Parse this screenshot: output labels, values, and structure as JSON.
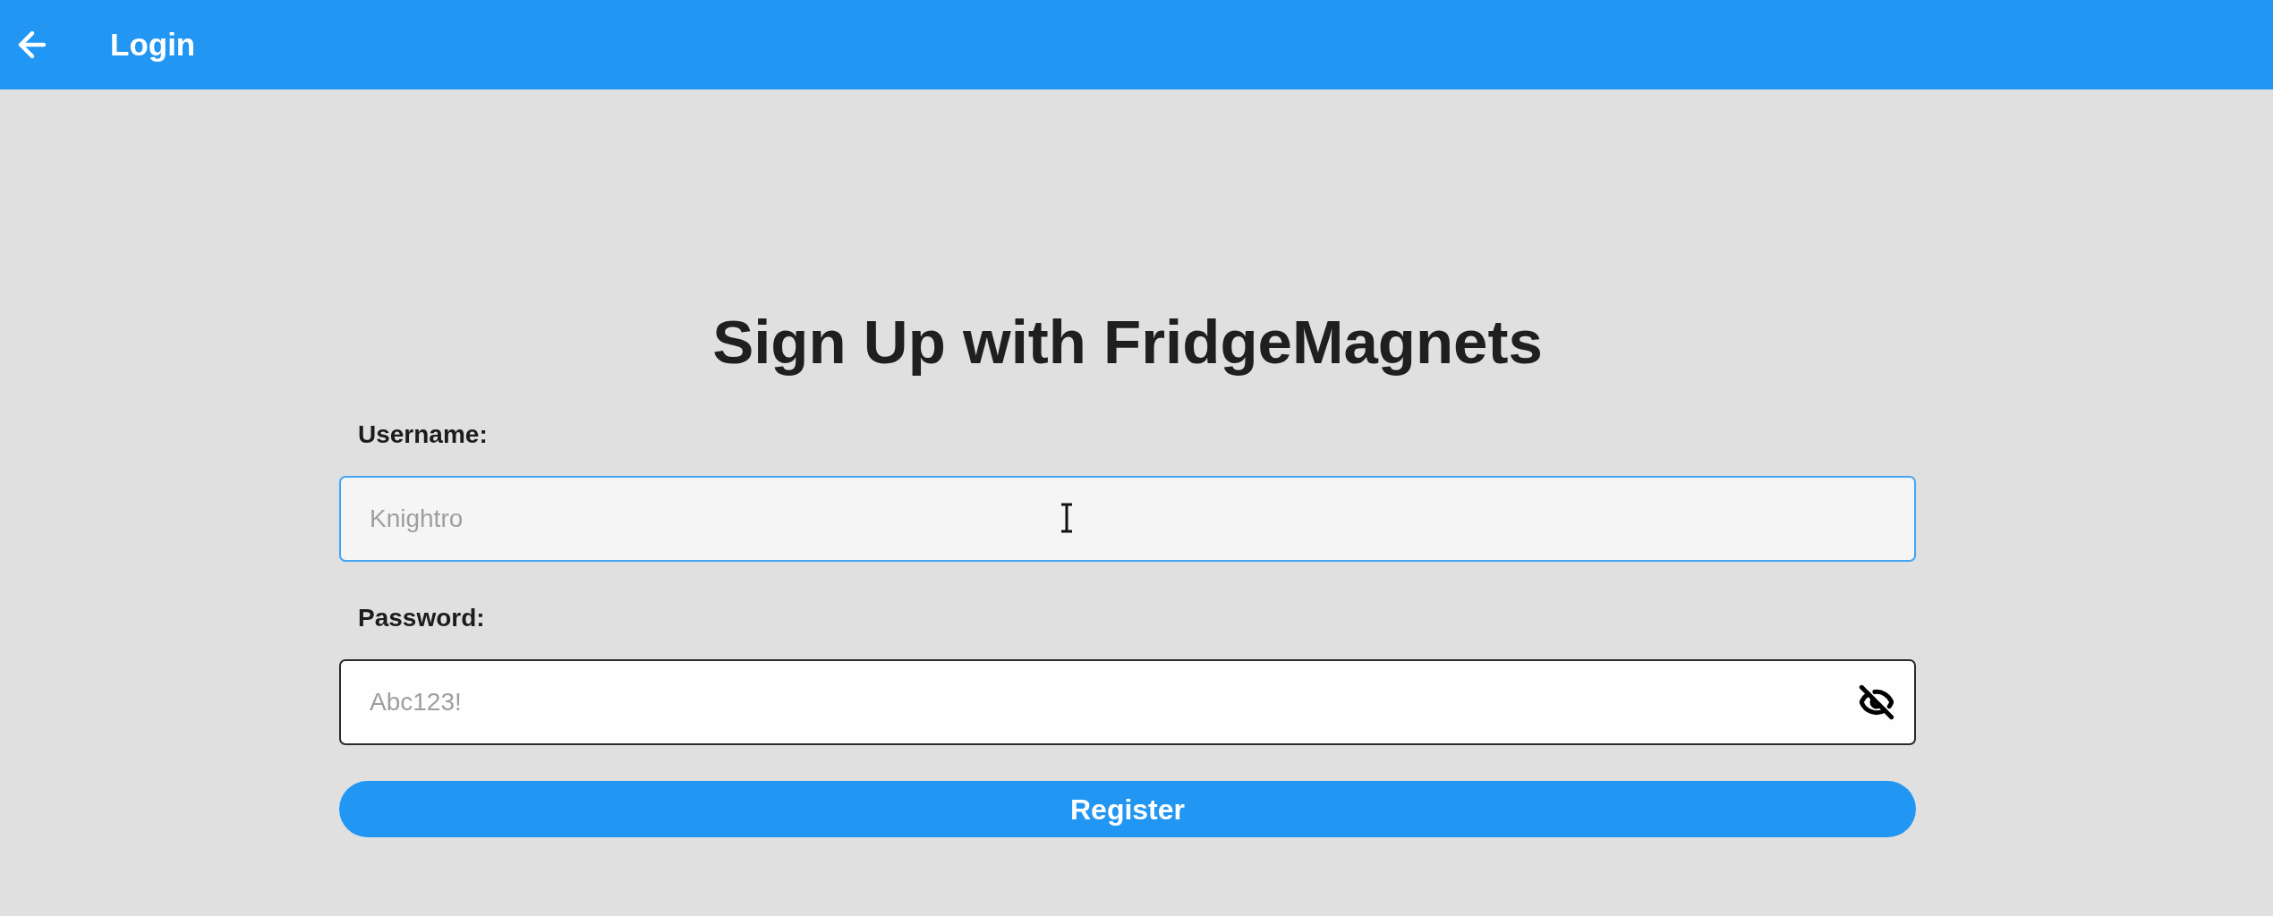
{
  "app_bar": {
    "title": "Login"
  },
  "heading": "Sign Up with FridgeMagnets",
  "fields": [
    {
      "kind": "text",
      "label": "Username:",
      "placeholder": "Knightro",
      "focused": true
    },
    {
      "kind": "password",
      "label": "Password:",
      "placeholder": "Abc123!",
      "focused": false,
      "obscured": true
    }
  ],
  "register_button": {
    "label": "Register"
  }
}
